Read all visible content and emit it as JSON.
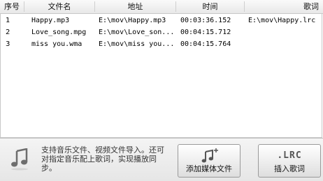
{
  "table": {
    "headers": [
      "序号",
      "文件名",
      "地址",
      "时间",
      "歌词"
    ],
    "rows": [
      [
        "1",
        "Happy.mp3",
        "E:\\mov\\Happy.mp3",
        "00:03:36.152",
        "E:\\mov\\Happy.lrc"
      ],
      [
        "2",
        "Love_song.mpg",
        "E:\\mov\\Love_son...",
        "00:04:15.712",
        ""
      ],
      [
        "3",
        "miss you.wma",
        "E:\\mov\\miss you...",
        "00:04:15.764",
        ""
      ]
    ]
  },
  "bottom": {
    "info": "支持音乐文件、视频文件导入。还可对指定音乐配上歌词，实现播放同步。",
    "add_media_label": "添加媒体文件",
    "insert_lyrics_label": "插入歌词",
    "lrc_icon_text": ".LRC",
    "music_icon": "music-note-icon",
    "add_music_icon": "music-note-plus-icon"
  }
}
